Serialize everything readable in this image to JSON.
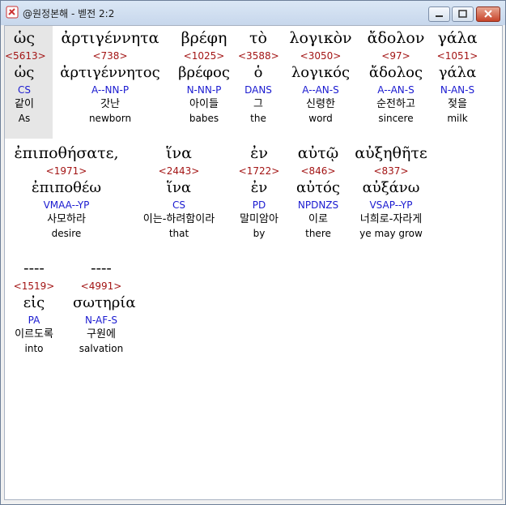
{
  "window": {
    "title": "@원정본해 - 벧전 2:2"
  },
  "rows": [
    [
      {
        "greek": "ὡς",
        "strong": "<5613>",
        "lemma": "ὡς",
        "parse": "CS",
        "korean": "같이",
        "english": "As"
      },
      {
        "greek": "ἀρτιγέννητα",
        "strong": "<738>",
        "lemma": "ἀρτιγέννητος",
        "parse": "A--NN-P",
        "korean": "갓난",
        "english": "newborn"
      },
      {
        "greek": "βρέφη",
        "strong": "<1025>",
        "lemma": "βρέφος",
        "parse": "N-NN-P",
        "korean": "아이들",
        "english": "babes"
      },
      {
        "greek": "τὸ",
        "strong": "<3588>",
        "lemma": "ὁ",
        "parse": "DANS",
        "korean": "그",
        "english": "the"
      },
      {
        "greek": "λογικὸν",
        "strong": "<3050>",
        "lemma": "λογικός",
        "parse": "A--AN-S",
        "korean": "신령한",
        "english": "word"
      },
      {
        "greek": "ἄδολον",
        "strong": "<97>",
        "lemma": "ἄδολος",
        "parse": "A--AN-S",
        "korean": "순전하고",
        "english": "sincere"
      },
      {
        "greek": "γάλα",
        "strong": "<1051>",
        "lemma": "γάλα",
        "parse": "N-AN-S",
        "korean": "젖을",
        "english": "milk"
      }
    ],
    [
      {
        "greek": "ἐπιποθήσατε,",
        "strong": "<1971>",
        "lemma": "ἐπιποθέω",
        "parse": "VMAA--YP",
        "korean": "사모하라",
        "english": "desire"
      },
      {
        "greek": "ἵνα",
        "strong": "<2443>",
        "lemma": "ἵνα",
        "parse": "CS",
        "korean": "이는-하려함이라",
        "english": "that"
      },
      {
        "greek": "ἐν",
        "strong": "<1722>",
        "lemma": "ἐν",
        "parse": "PD",
        "korean": "말미암아",
        "english": "by"
      },
      {
        "greek": "αὐτῷ",
        "strong": "<846>",
        "lemma": "αὐτός",
        "parse": "NPDNZS",
        "korean": "이로",
        "english": "there"
      },
      {
        "greek": "αὐξηθῆτε",
        "strong": "<837>",
        "lemma": "αὐξάνω",
        "parse": "VSAP--YP",
        "korean": "너희로-자라게",
        "english": "ye may grow"
      }
    ],
    [
      {
        "greek": "----",
        "strong": "<1519>",
        "lemma": "εἰς",
        "parse": "PA",
        "korean": "이르도록",
        "english": "into"
      },
      {
        "greek": "----",
        "strong": "<4991>",
        "lemma": "σωτηρία",
        "parse": "N-AF-S",
        "korean": "구원에",
        "english": "salvation"
      }
    ]
  ]
}
